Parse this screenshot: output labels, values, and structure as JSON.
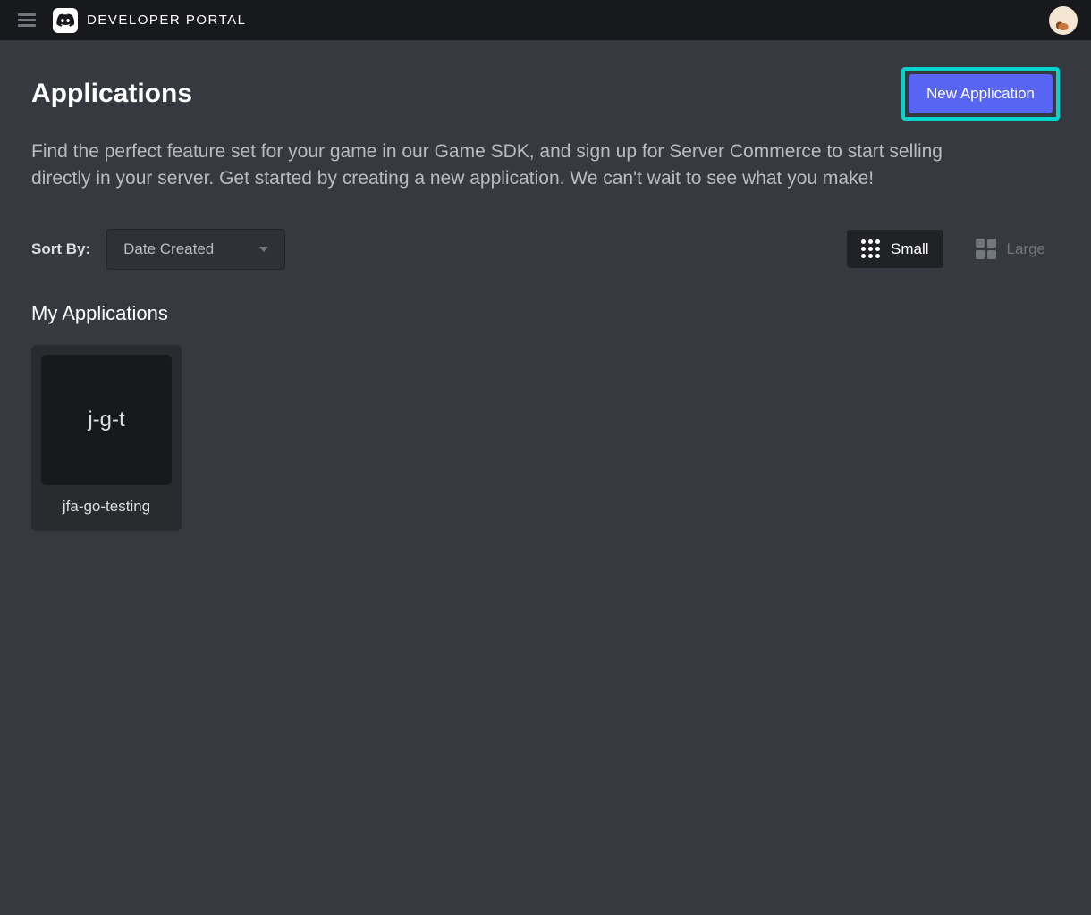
{
  "topbar": {
    "portal_title": "DEVELOPER PORTAL"
  },
  "header": {
    "page_title": "Applications",
    "new_app_label": "New Application"
  },
  "description": "Find the perfect feature set for your game in our Game SDK, and sign up for Server Commerce to start selling directly in your server. Get started by creating a new application. We can't wait to see what you make!",
  "sort": {
    "label": "Sort By:",
    "selected": "Date Created"
  },
  "view": {
    "small_label": "Small",
    "large_label": "Large"
  },
  "section_title": "My Applications",
  "apps": [
    {
      "short": "j-g-t",
      "name": "jfa-go-testing"
    }
  ]
}
